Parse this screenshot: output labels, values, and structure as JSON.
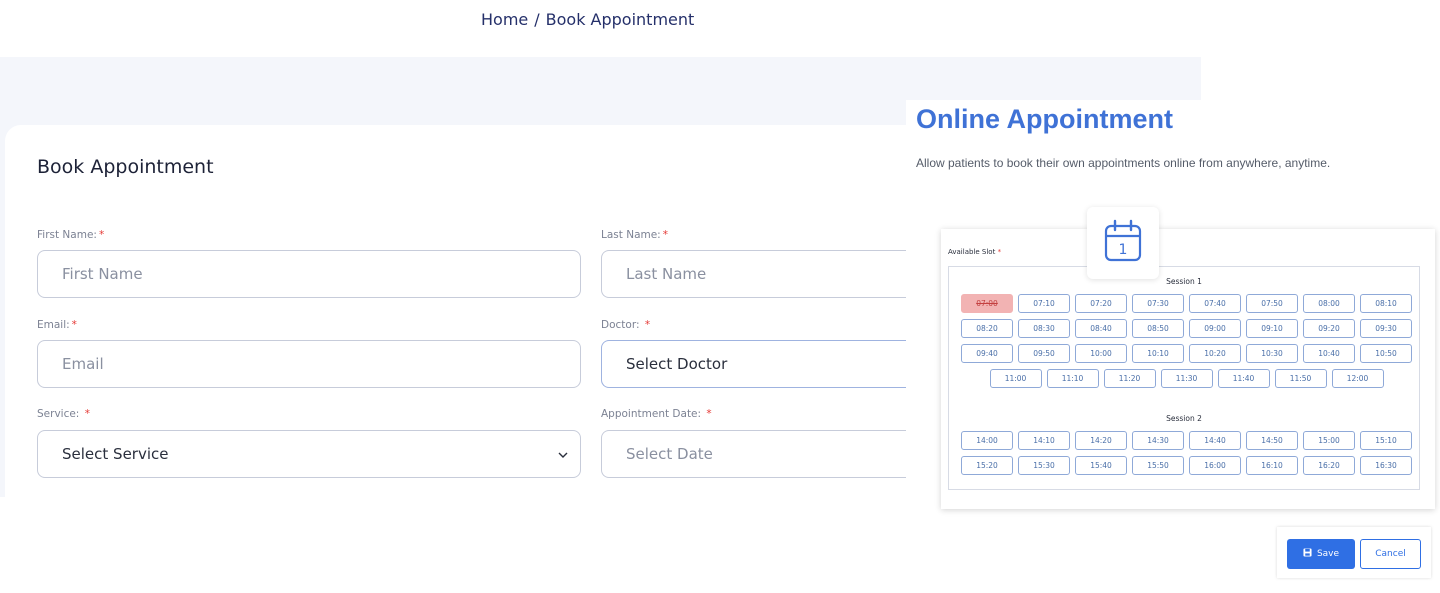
{
  "breadcrumb": {
    "home": "Home",
    "separator": "/",
    "current": "Book Appointment"
  },
  "form": {
    "title": "Book Appointment",
    "first_name": {
      "label": "First Name:",
      "required": "*",
      "placeholder": "First Name"
    },
    "last_name": {
      "label": "Last Name:",
      "required": "*",
      "placeholder": "Last Name"
    },
    "email": {
      "label": "Email:",
      "required": "*",
      "placeholder": "Email"
    },
    "doctor": {
      "label": "Doctor: ",
      "required": "*",
      "value": "Select Doctor"
    },
    "service": {
      "label": "Service: ",
      "required": "*",
      "value": "Select Service"
    },
    "appointment_date": {
      "label": "Appointment Date: ",
      "required": "*",
      "placeholder": "Select Date"
    }
  },
  "promo": {
    "title": "Online Appointment",
    "description": "Allow patients to book their own appointments online from anywhere, anytime.",
    "calendar_day": "1",
    "available_slot_label": "Available Slot ",
    "required": "*",
    "sessions": [
      {
        "title": "Session 1",
        "rows": [
          [
            "07:00",
            "07:10",
            "07:20",
            "07:30",
            "07:40",
            "07:50",
            "08:00",
            "08:10"
          ],
          [
            "08:20",
            "08:30",
            "08:40",
            "08:50",
            "09:00",
            "09:10",
            "09:20",
            "09:30"
          ],
          [
            "09:40",
            "09:50",
            "10:00",
            "10:10",
            "10:20",
            "10:30",
            "10:40",
            "10:50"
          ],
          [
            "11:00",
            "11:10",
            "11:20",
            "11:30",
            "11:40",
            "11:50",
            "12:00"
          ]
        ],
        "booked": [
          "07:00"
        ]
      },
      {
        "title": "Session 2",
        "rows": [
          [
            "14:00",
            "14:10",
            "14:20",
            "14:30",
            "14:40",
            "14:50",
            "15:00",
            "15:10"
          ],
          [
            "15:20",
            "15:30",
            "15:40",
            "15:50",
            "16:00",
            "16:10",
            "16:20",
            "16:30"
          ]
        ],
        "booked": []
      }
    ],
    "save_label": "Save",
    "cancel_label": "Cancel"
  },
  "colors": {
    "accent": "#2f6fe4",
    "title_blue": "#3f72d6",
    "booked": "#f2b3b3",
    "required": "#e53935"
  },
  "icons": {
    "calendar": "calendar-icon",
    "save": "floppy-disk-icon",
    "select": "chevron-down-icon"
  }
}
